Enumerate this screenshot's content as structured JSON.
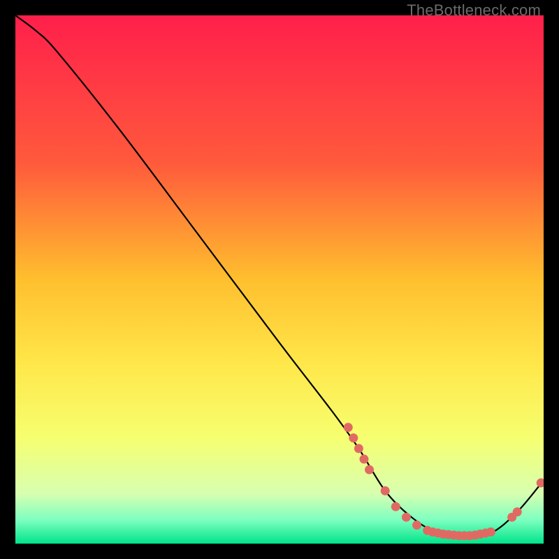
{
  "watermark": "TheBottleneck.com",
  "chart_data": {
    "type": "line",
    "title": "",
    "xlabel": "",
    "ylabel": "",
    "xlim": [
      0,
      100
    ],
    "ylim": [
      0,
      100
    ],
    "gradient_stops": [
      {
        "offset": 0,
        "color": "#ff1f4b"
      },
      {
        "offset": 0.28,
        "color": "#ff5a3c"
      },
      {
        "offset": 0.5,
        "color": "#ffbf2e"
      },
      {
        "offset": 0.66,
        "color": "#ffe74a"
      },
      {
        "offset": 0.8,
        "color": "#f6ff70"
      },
      {
        "offset": 0.905,
        "color": "#d8ffb0"
      },
      {
        "offset": 0.955,
        "color": "#7effc0"
      },
      {
        "offset": 1.0,
        "color": "#00e48a"
      }
    ],
    "series": [
      {
        "name": "bottleneck-curve",
        "x": [
          0,
          4,
          8,
          20,
          35,
          50,
          60,
          65,
          70,
          75,
          80,
          85,
          90,
          95,
          100
        ],
        "y": [
          100,
          97,
          93,
          78,
          58,
          38,
          25,
          18,
          10,
          5,
          2,
          1.5,
          2,
          6,
          12
        ]
      }
    ],
    "highlight_points": {
      "name": "marker-cluster",
      "color": "#e06a63",
      "points": [
        {
          "x": 63,
          "y": 22
        },
        {
          "x": 64,
          "y": 20
        },
        {
          "x": 65,
          "y": 18
        },
        {
          "x": 66,
          "y": 16
        },
        {
          "x": 67,
          "y": 14
        },
        {
          "x": 70,
          "y": 10
        },
        {
          "x": 72,
          "y": 7
        },
        {
          "x": 74,
          "y": 5
        },
        {
          "x": 76,
          "y": 3.5
        },
        {
          "x": 78,
          "y": 2.5
        },
        {
          "x": 79,
          "y": 2.2
        },
        {
          "x": 80,
          "y": 2.0
        },
        {
          "x": 81,
          "y": 1.8
        },
        {
          "x": 82,
          "y": 1.7
        },
        {
          "x": 83,
          "y": 1.6
        },
        {
          "x": 84,
          "y": 1.5
        },
        {
          "x": 85,
          "y": 1.5
        },
        {
          "x": 86,
          "y": 1.5
        },
        {
          "x": 87,
          "y": 1.6
        },
        {
          "x": 88,
          "y": 1.8
        },
        {
          "x": 89,
          "y": 2.0
        },
        {
          "x": 90,
          "y": 2.2
        },
        {
          "x": 94,
          "y": 5.0
        },
        {
          "x": 95,
          "y": 6.0
        },
        {
          "x": 99.5,
          "y": 11.5
        }
      ]
    }
  }
}
